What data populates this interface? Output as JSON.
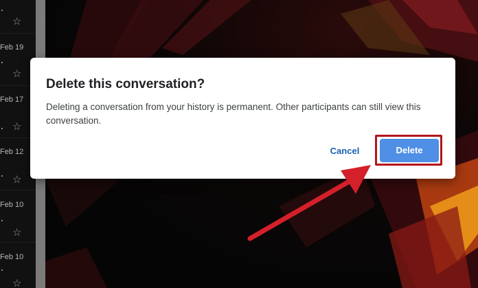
{
  "dialog": {
    "title": "Delete this conversation?",
    "body": "Deleting a conversation from your history is permanent. Other participants can still view this conversation.",
    "cancel_label": "Cancel",
    "delete_label": "Delete"
  },
  "list": {
    "dates": [
      "Feb 19",
      "Feb 17",
      "Feb 12",
      "Feb 10",
      "Feb 10"
    ]
  },
  "colors": {
    "delete_button": "#4f8fe6",
    "cancel_text": "#1a5fb4",
    "highlight": "#b3141d",
    "arrow": "#d3202a"
  },
  "icons": [
    "star-icon",
    "arrow-annotation"
  ]
}
